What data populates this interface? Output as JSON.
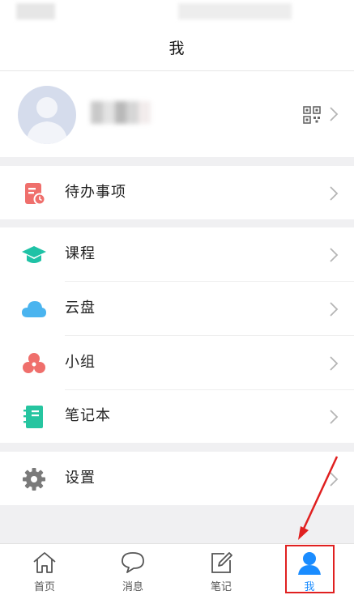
{
  "header": {
    "title": "我"
  },
  "profile": {
    "qr_icon": "qr-code-icon",
    "chevron_icon": "chevron-right-icon"
  },
  "menu": {
    "todo": {
      "label": "待办事项",
      "icon": "todo-list-icon",
      "color": "#ef6f6c"
    },
    "course": {
      "label": "课程",
      "icon": "graduation-cap-icon",
      "color": "#1fc2a6"
    },
    "cloud": {
      "label": "云盘",
      "icon": "cloud-icon",
      "color": "#4ab4ef"
    },
    "group": {
      "label": "小组",
      "icon": "group-icon",
      "color": "#ef6f6c"
    },
    "notebook": {
      "label": "笔记本",
      "icon": "notebook-icon",
      "color": "#26c5a0"
    },
    "settings": {
      "label": "设置",
      "icon": "gear-icon",
      "color": "#7a7a7a"
    }
  },
  "tabbar": {
    "home": {
      "label": "首页",
      "icon": "home-icon"
    },
    "messages": {
      "label": "消息",
      "icon": "chat-bubble-icon"
    },
    "notes": {
      "label": "笔记",
      "icon": "edit-note-icon"
    },
    "me": {
      "label": "我",
      "icon": "user-icon",
      "active": true
    }
  },
  "colors": {
    "accent": "#1a8cff",
    "annotation": "#e02020"
  }
}
